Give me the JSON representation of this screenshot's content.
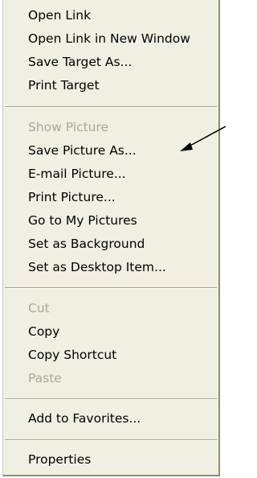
{
  "menu": {
    "items": [
      {
        "label": "Open Link",
        "enabled": true
      },
      {
        "label": "Open Link in New Window",
        "enabled": true
      },
      {
        "label": "Save Target As...",
        "enabled": true
      },
      {
        "label": "Print Target",
        "enabled": true
      },
      {
        "label": "Show Picture",
        "enabled": false
      },
      {
        "label": "Save Picture As...",
        "enabled": true
      },
      {
        "label": "E-mail Picture...",
        "enabled": true
      },
      {
        "label": "Print Picture...",
        "enabled": true
      },
      {
        "label": "Go to My Pictures",
        "enabled": true
      },
      {
        "label": "Set as Background",
        "enabled": true
      },
      {
        "label": "Set as Desktop Item...",
        "enabled": true
      },
      {
        "label": "Cut",
        "enabled": false
      },
      {
        "label": "Copy",
        "enabled": true
      },
      {
        "label": "Copy Shortcut",
        "enabled": true
      },
      {
        "label": "Paste",
        "enabled": false
      },
      {
        "label": "Add to Favorites...",
        "enabled": true
      },
      {
        "label": "Properties",
        "enabled": true
      }
    ]
  },
  "colors": {
    "menu_background": "#f1efe2",
    "disabled_text": "#a9a79c",
    "separator": "#a7a392",
    "annotation_arrow": "#000000"
  }
}
